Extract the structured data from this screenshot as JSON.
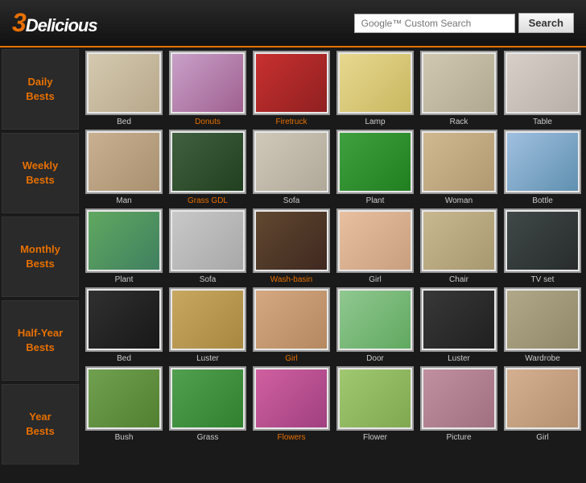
{
  "header": {
    "logo_3": "3",
    "logo_rest": "Delicious",
    "search_placeholder": "Google™ Custom Search",
    "search_label": "Search"
  },
  "sidebar": {
    "items": [
      {
        "id": "daily",
        "label": "Daily\nBests"
      },
      {
        "id": "weekly",
        "label": "Weekly\nBests"
      },
      {
        "id": "monthly",
        "label": "Monthly\nBests"
      },
      {
        "id": "halfyear",
        "label": "Half-Year\nBests"
      },
      {
        "id": "year",
        "label": "Year\nBests"
      }
    ]
  },
  "rows": [
    {
      "items": [
        {
          "label": "Bed",
          "color": "t-bed",
          "orange": false
        },
        {
          "label": "Donuts",
          "color": "t-donuts",
          "orange": true
        },
        {
          "label": "Firetruck",
          "color": "t-firetruck",
          "orange": true
        },
        {
          "label": "Lamp",
          "color": "t-lamp",
          "orange": false
        },
        {
          "label": "Rack",
          "color": "t-rack",
          "orange": false
        },
        {
          "label": "Table",
          "color": "t-table",
          "orange": false
        }
      ]
    },
    {
      "items": [
        {
          "label": "Man",
          "color": "t-man",
          "orange": false
        },
        {
          "label": "Grass GDL",
          "color": "t-grass",
          "orange": true
        },
        {
          "label": "Sofa",
          "color": "t-sofa",
          "orange": false
        },
        {
          "label": "Plant",
          "color": "t-plant",
          "orange": false
        },
        {
          "label": "Woman",
          "color": "t-woman",
          "orange": false
        },
        {
          "label": "Bottle",
          "color": "t-bottle",
          "orange": false
        }
      ]
    },
    {
      "items": [
        {
          "label": "Plant",
          "color": "t-plant2",
          "orange": false
        },
        {
          "label": "Sofa",
          "color": "t-sofa2",
          "orange": false
        },
        {
          "label": "Wash-basin",
          "color": "t-washbasin",
          "orange": true
        },
        {
          "label": "Girl",
          "color": "t-girl",
          "orange": false
        },
        {
          "label": "Chair",
          "color": "t-chair",
          "orange": false
        },
        {
          "label": "TV set",
          "color": "t-tvset",
          "orange": false
        }
      ]
    },
    {
      "items": [
        {
          "label": "Bed",
          "color": "t-bed2",
          "orange": false
        },
        {
          "label": "Luster",
          "color": "t-luster",
          "orange": false
        },
        {
          "label": "Girl",
          "color": "t-girl2",
          "orange": true
        },
        {
          "label": "Door",
          "color": "t-door",
          "orange": false
        },
        {
          "label": "Luster",
          "color": "t-luster2",
          "orange": false
        },
        {
          "label": "Wardrobe",
          "color": "t-wardrobe",
          "orange": false
        }
      ]
    },
    {
      "items": [
        {
          "label": "Bush",
          "color": "t-bush",
          "orange": false
        },
        {
          "label": "Grass",
          "color": "t-grass2",
          "orange": false
        },
        {
          "label": "Flowers",
          "color": "t-flowers",
          "orange": true
        },
        {
          "label": "Flower",
          "color": "t-flower",
          "orange": false
        },
        {
          "label": "Picture",
          "color": "t-picture",
          "orange": false
        },
        {
          "label": "Girl",
          "color": "t-girl3",
          "orange": false
        }
      ]
    }
  ]
}
